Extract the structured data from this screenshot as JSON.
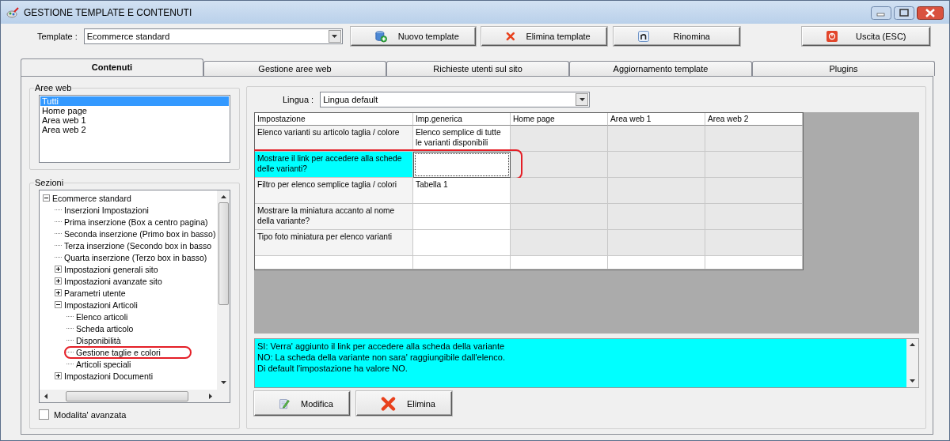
{
  "window": {
    "title": "GESTIONE TEMPLATE E CONTENUTI"
  },
  "template": {
    "label": "Template :",
    "value": "Ecommerce standard"
  },
  "toolbar": [
    {
      "label": "Nuovo template",
      "kind": "new"
    },
    {
      "label": "Elimina template",
      "kind": "delete"
    },
    {
      "label": "Rinomina",
      "kind": "rename"
    },
    {
      "label": "Uscita (ESC)",
      "kind": "exit"
    }
  ],
  "tabs": [
    {
      "label": "Contenuti",
      "selected": true
    },
    {
      "label": "Gestione aree web",
      "selected": false
    },
    {
      "label": "Richieste utenti sul sito",
      "selected": false
    },
    {
      "label": "Aggiornamento template",
      "selected": false
    },
    {
      "label": "Plugins",
      "selected": false
    }
  ],
  "aree_web": {
    "title": "Aree web",
    "items": [
      {
        "label": "Tutti",
        "selected": true
      },
      {
        "label": "Home page",
        "selected": false
      },
      {
        "label": "Area web 1",
        "selected": false
      },
      {
        "label": "Area web 2",
        "selected": false
      }
    ]
  },
  "sezioni": {
    "title": "Sezioni",
    "tree": [
      {
        "label": "Ecommerce standard",
        "kind": "node",
        "expanded": true,
        "circled": false,
        "children": [
          {
            "label": "Inserzioni Impostazioni",
            "kind": "leaf",
            "circled": false
          },
          {
            "label": "Prima inserzione (Box a centro pagina)",
            "kind": "leaf",
            "circled": false
          },
          {
            "label": "Seconda inserzione (Primo box in basso)",
            "kind": "leaf",
            "circled": false
          },
          {
            "label": "Terza inserzione (Secondo box in basso",
            "kind": "leaf",
            "circled": false
          },
          {
            "label": "Quarta inserzione (Terzo box in basso)",
            "kind": "leaf",
            "circled": false
          },
          {
            "label": "Impostazioni generali sito",
            "kind": "node",
            "expanded": false,
            "circled": false
          },
          {
            "label": "Impostazioni avanzate sito",
            "kind": "node",
            "expanded": false,
            "circled": false
          },
          {
            "label": "Parametri utente",
            "kind": "node",
            "expanded": false,
            "circled": false
          },
          {
            "label": "Impostazioni Articoli",
            "kind": "node",
            "expanded": true,
            "circled": false,
            "children": [
              {
                "label": "Elenco articoli",
                "kind": "leaf",
                "circled": false
              },
              {
                "label": "Scheda articolo",
                "kind": "leaf",
                "circled": false
              },
              {
                "label": "Disponibilità",
                "kind": "leaf",
                "circled": false
              },
              {
                "label": "Gestione taglie e colori",
                "kind": "leaf",
                "circled": true
              },
              {
                "label": "Articoli speciali",
                "kind": "leaf",
                "circled": false
              }
            ]
          },
          {
            "label": "Impostazioni Documenti",
            "kind": "node",
            "expanded": false,
            "circled": false
          }
        ]
      }
    ]
  },
  "advanced_mode": {
    "label": "Modalita' avanzata",
    "checked": false
  },
  "lingua": {
    "label": "Lingua :",
    "value": "Lingua default"
  },
  "grid": {
    "columns": [
      {
        "label": "Impostazione",
        "disabled": false
      },
      {
        "label": "Imp.generica",
        "disabled": false
      },
      {
        "label": "Home page",
        "disabled": true
      },
      {
        "label": "Area web 1",
        "disabled": true
      },
      {
        "label": "Area web 2",
        "disabled": true
      }
    ],
    "rows": [
      {
        "cells": [
          "Elenco varianti su articolo taglia / colore",
          "Elenco semplice di tutte le varianti disponibili"
        ],
        "selected": false,
        "circled": false
      },
      {
        "cells": [
          "Mostrare il link per accedere alla schede delle varianti?",
          ""
        ],
        "selected": true,
        "circled": true
      },
      {
        "cells": [
          "Filtro per elenco semplice taglia / colori",
          "Tabella 1"
        ],
        "selected": false,
        "circled": false
      },
      {
        "cells": [
          "Mostrare la miniatura accanto al nome della variante?",
          ""
        ],
        "selected": false,
        "circled": false
      },
      {
        "cells": [
          "Tipo foto miniatura per elenco varianti",
          ""
        ],
        "selected": false,
        "circled": false
      }
    ]
  },
  "description": {
    "lines": [
      "SI: Verra' aggiunto il link per accedere alla scheda della variante",
      "NO: La scheda della variante non sara' raggiungibile dall'elenco.",
      "Di default l'impostazione ha valore NO."
    ]
  },
  "actions": [
    {
      "label": "Modifica",
      "kind": "edit"
    },
    {
      "label": "Elimina",
      "kind": "delete"
    }
  ]
}
